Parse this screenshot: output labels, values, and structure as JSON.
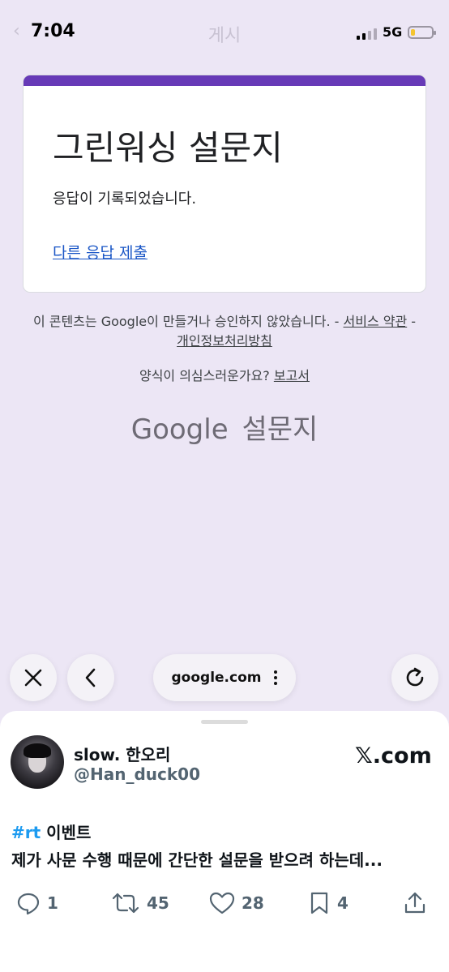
{
  "status_bar": {
    "time": "7:04",
    "network": "5G",
    "battery_level": 0.2,
    "faded_header": "게시"
  },
  "form": {
    "accent_color": "#673ab7",
    "title": "그린워싱 설문지",
    "message": "응답이 기록되었습니다.",
    "submit_another": "다른 응답 제출"
  },
  "footer": {
    "disclaimer": "이 콘텐츠는 Google이 만들거나 승인하지 않았습니다. - ",
    "terms_link": "서비스 약관",
    "separator": " - ",
    "privacy_link": "개인정보처리방침",
    "report_question": "양식이 의심스러운가요? ",
    "report_link": "보고서",
    "logo_google": "Google",
    "logo_product": "설문지"
  },
  "browser": {
    "url": "google.com",
    "buttons": [
      "close-icon",
      "back-icon",
      "more-icon",
      "reload-icon"
    ]
  },
  "tweet": {
    "display_name": "slow. 한오리",
    "handle": "@Han_duck00",
    "source": "𝕏.com",
    "hashtag": "#rt",
    "line1_rest": " 이벤트",
    "line2": "제가 사문 수행 때문에 간단한 설문을 받으려 하는데...",
    "replies": "1",
    "retweets": "45",
    "likes": "28",
    "bookmarks": "4"
  }
}
